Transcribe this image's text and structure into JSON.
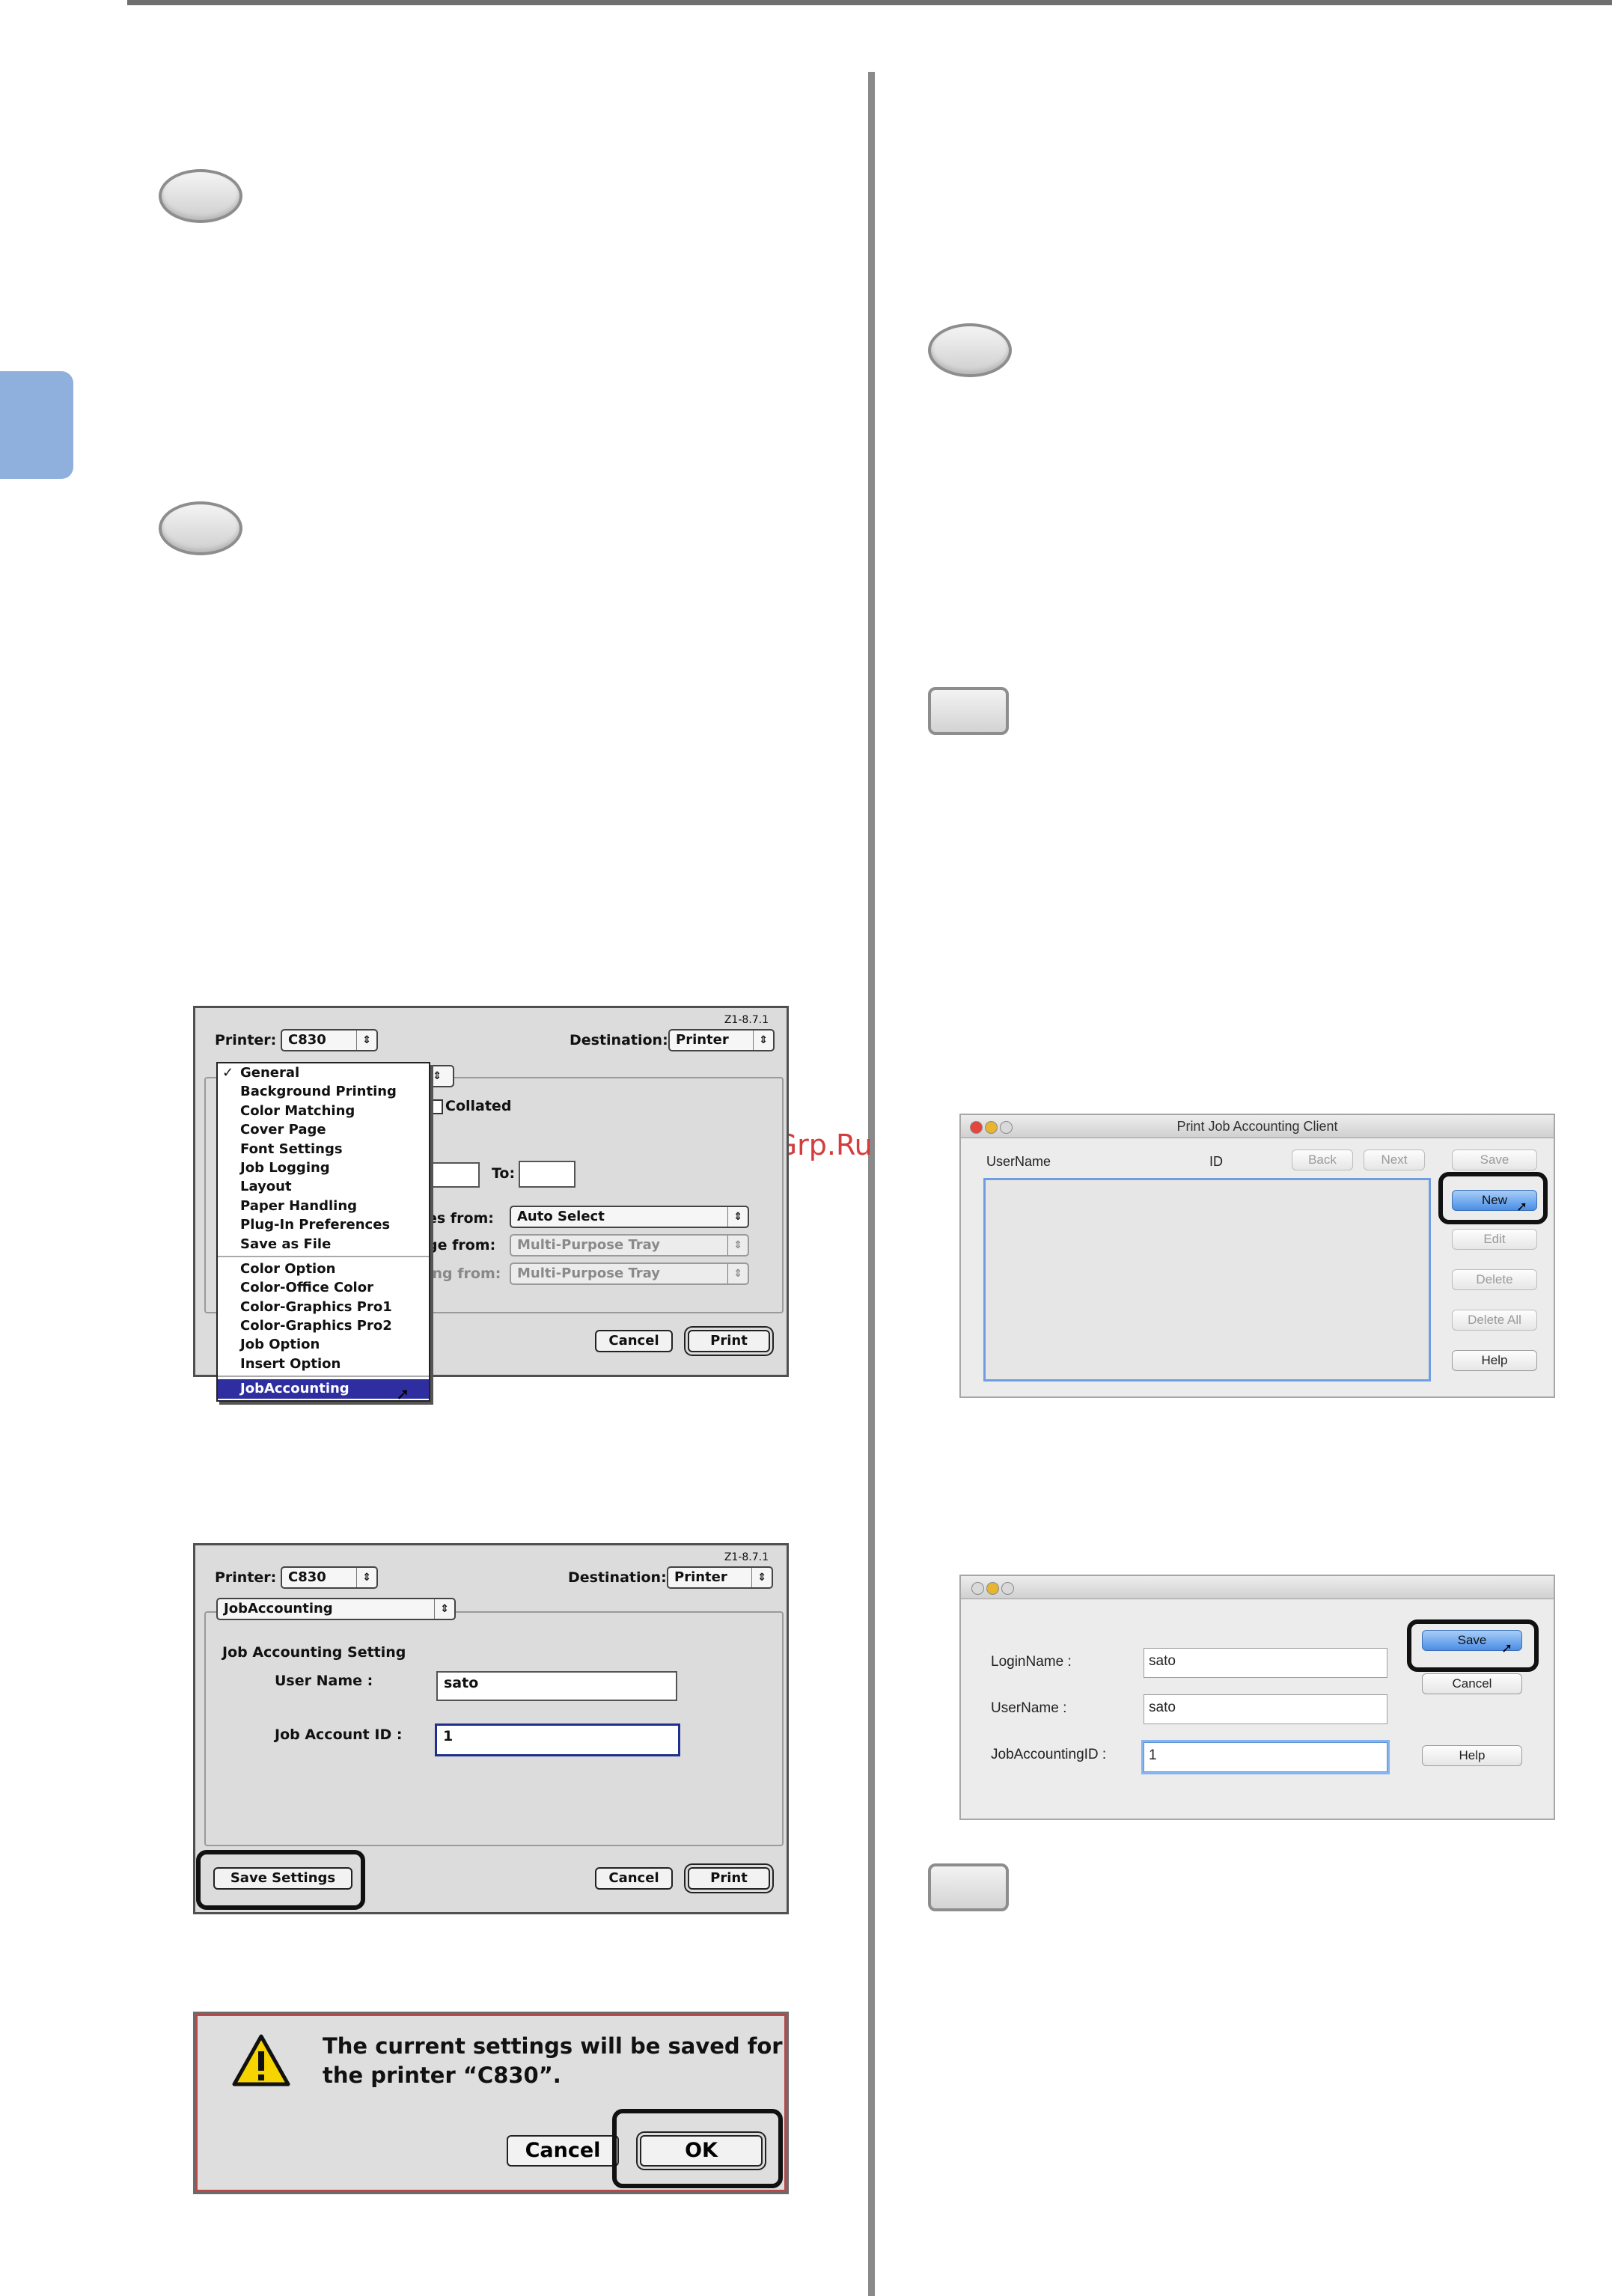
{
  "watermark": "McGrp.Ru",
  "dialog_print_general": {
    "version": "Z1-8.7.1",
    "printer_label": "Printer:",
    "printer_value": "C830",
    "destination_label": "Destination:",
    "destination_value": "Printer",
    "collated_label": "Collated",
    "to_label": "To:",
    "row1_label": "es from:",
    "row1_value": "Auto Select",
    "row2_label": "ge from:",
    "row2_value": "Multi-Purpose Tray",
    "row3_label": "ing from:",
    "row3_value": "Multi-Purpose Tray",
    "cancel_label": "Cancel",
    "print_label": "Print",
    "menu": {
      "items_group1": [
        "General",
        "Background Printing",
        "Color Matching",
        "Cover Page",
        "Font Settings",
        "Job Logging",
        "Layout",
        "Paper Handling",
        "Plug-In Preferences",
        "Save as File"
      ],
      "items_group2": [
        "Color Option",
        "Color-Office Color",
        "Color-Graphics Pro1",
        "Color-Graphics Pro2",
        "Job Option",
        "Insert Option"
      ],
      "selected_item": "JobAccounting"
    }
  },
  "dialog_print_jobaccounting": {
    "version": "Z1-8.7.1",
    "printer_label": "Printer:",
    "printer_value": "C830",
    "destination_label": "Destination:",
    "destination_value": "Printer",
    "panel_popup": "JobAccounting",
    "section_title": "Job Accounting Setting",
    "user_name_label": "User Name :",
    "user_name_value": "sato",
    "job_account_id_label": "Job Account ID :",
    "job_account_id_value": "1",
    "save_settings_label": "Save Settings",
    "cancel_label": "Cancel",
    "print_label": "Print"
  },
  "alert_dialog": {
    "message_line1": "The current settings will be saved for",
    "message_line2": "the printer “C830”.",
    "cancel_label": "Cancel",
    "ok_label": "OK"
  },
  "pjac_window": {
    "title": "Print Job Accounting Client",
    "col_username": "UserName",
    "col_id": "ID",
    "back_label": "Back",
    "next_label": "Next",
    "save_label": "Save",
    "new_label": "New",
    "edit_label": "Edit",
    "delete_label": "Delete",
    "delete_all_label": "Delete All",
    "help_label": "Help"
  },
  "user_edit_window": {
    "login_name_label": "LoginName :",
    "login_name_value": "sato",
    "user_name_label": "UserName :",
    "user_name_value": "sato",
    "job_accounting_id_label": "JobAccountingID :",
    "job_accounting_id_value": "1",
    "save_label": "Save",
    "cancel_label": "Cancel",
    "help_label": "Help"
  },
  "colors": {
    "side_tab": "#8fb0dc",
    "menu_selection": "#2e2ea0",
    "focus_ring": "#86b4ee",
    "button_blue": "#4a8ee6"
  }
}
